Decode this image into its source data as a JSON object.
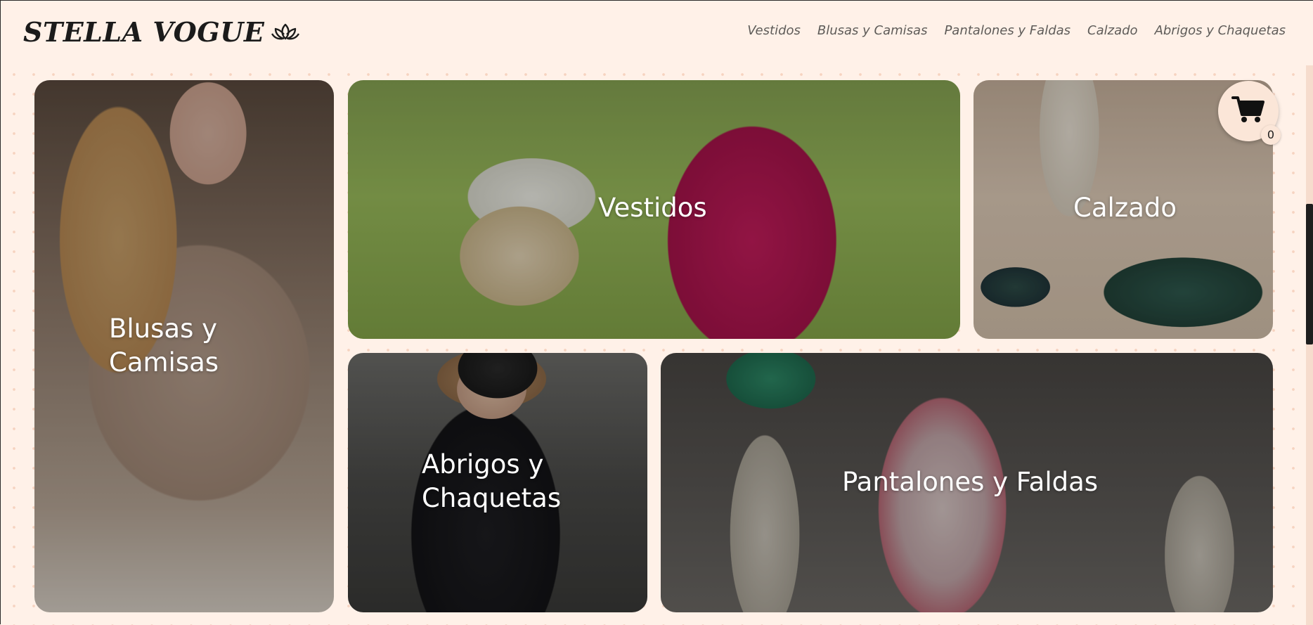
{
  "header": {
    "brand": "STELLA VOGUE",
    "brand_icon": "lotus-icon",
    "nav": [
      {
        "label": "Vestidos"
      },
      {
        "label": "Blusas y Camisas"
      },
      {
        "label": "Pantalones y Faldas"
      },
      {
        "label": "Calzado"
      },
      {
        "label": "Abrigos y Chaquetas"
      }
    ]
  },
  "categories": {
    "blusas": {
      "label_line1": "Blusas y",
      "label_line2": "Camisas"
    },
    "vestidos": {
      "label": "Vestidos"
    },
    "calzado": {
      "label": "Calzado"
    },
    "abrigos": {
      "label_line1": "Abrigos y",
      "label_line2": "Chaquetas"
    },
    "pantalones": {
      "label": "Pantalones y Faldas"
    }
  },
  "cart": {
    "icon": "cart-icon",
    "count": "0"
  },
  "colors": {
    "background": "#fff1e8",
    "dots": "#f6d3c0",
    "brand_text": "#1b1b1b",
    "nav_text": "#5e5b58",
    "cart_bg": "#fbe6d8",
    "scroll_thumb": "#1e1e1e"
  }
}
